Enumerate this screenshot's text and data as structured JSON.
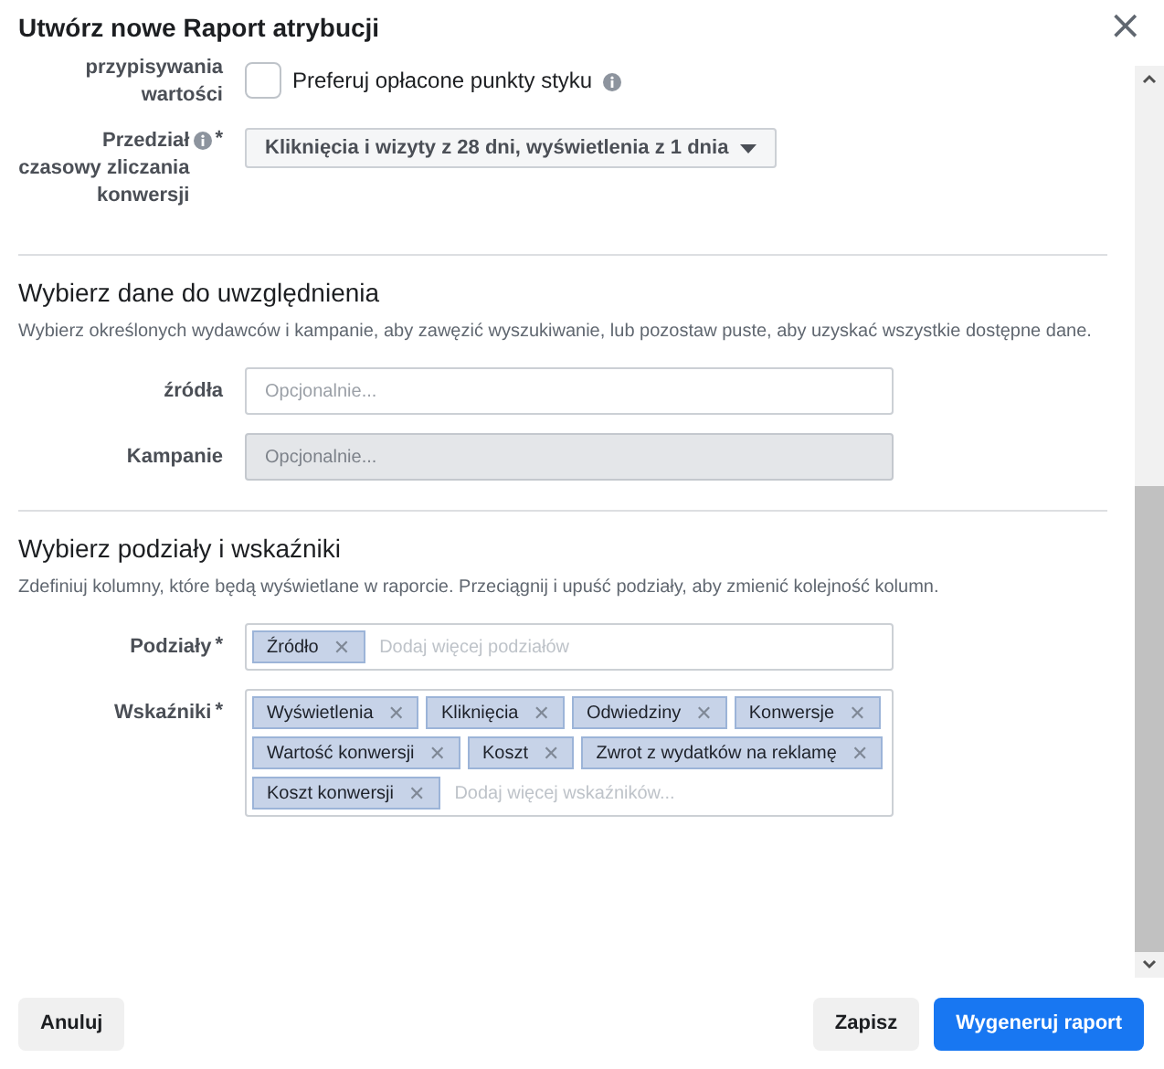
{
  "dialog": {
    "title": "Utwórz nowe Raport atrybucji",
    "close": "×"
  },
  "required_mark": "*",
  "remove_glyph": "✕",
  "settings": [
    {
      "kind": "checkbox",
      "label": "przypisywania wartości",
      "info": true,
      "text": "Preferuj opłacone punkty styku",
      "checked": false
    },
    {
      "kind": "dropdown",
      "label": "Przedział czasowy zliczania konwersji",
      "required": true,
      "info": true,
      "value": "Kliknięcia i wizyty z 28 dni, wyświetlenia z 1 dnia"
    }
  ],
  "data_section": {
    "heading": "Wybierz dane do uwzględnienia",
    "description": "Wybierz określonych wydawców i kampanie, aby zawęzić wyszukiwanie, lub pozostaw puste, aby uzyskać wszystkie dostępne dane.",
    "fields": [
      {
        "label": "źródła",
        "placeholder": "Opcjonalnie...",
        "disabled": false
      },
      {
        "label": "Kampanie",
        "placeholder": "Opcjonalnie...",
        "disabled": true
      }
    ]
  },
  "breakdown_section": {
    "heading": "Wybierz podziały i wskaźniki",
    "description": "Zdefiniuj kolumny, które będą wyświetlane w raporcie. Przeciągnij i upuść podziały, aby zmienić kolejność kolumn.",
    "fields": [
      {
        "label": "Podziały",
        "required": true,
        "tags": [
          "Źródło"
        ],
        "placeholder": "Dodaj więcej podziałów"
      },
      {
        "label": "Wskaźniki",
        "required": true,
        "tags": [
          "Wyświetlenia",
          "Kliknięcia",
          "Odwiedziny",
          "Konwersje",
          "Wartość konwersji",
          "Koszt",
          "Zwrot z wydatków na reklamę",
          "Koszt konwersji"
        ],
        "placeholder": "Dodaj więcej wskaźników..."
      }
    ]
  },
  "footer": {
    "left_buttons": [
      {
        "label": "Anuluj",
        "kind": "secondary"
      }
    ],
    "right_buttons": [
      {
        "label": "Zapisz",
        "kind": "secondary"
      },
      {
        "label": "Wygeneruj raport",
        "kind": "primary"
      }
    ]
  }
}
